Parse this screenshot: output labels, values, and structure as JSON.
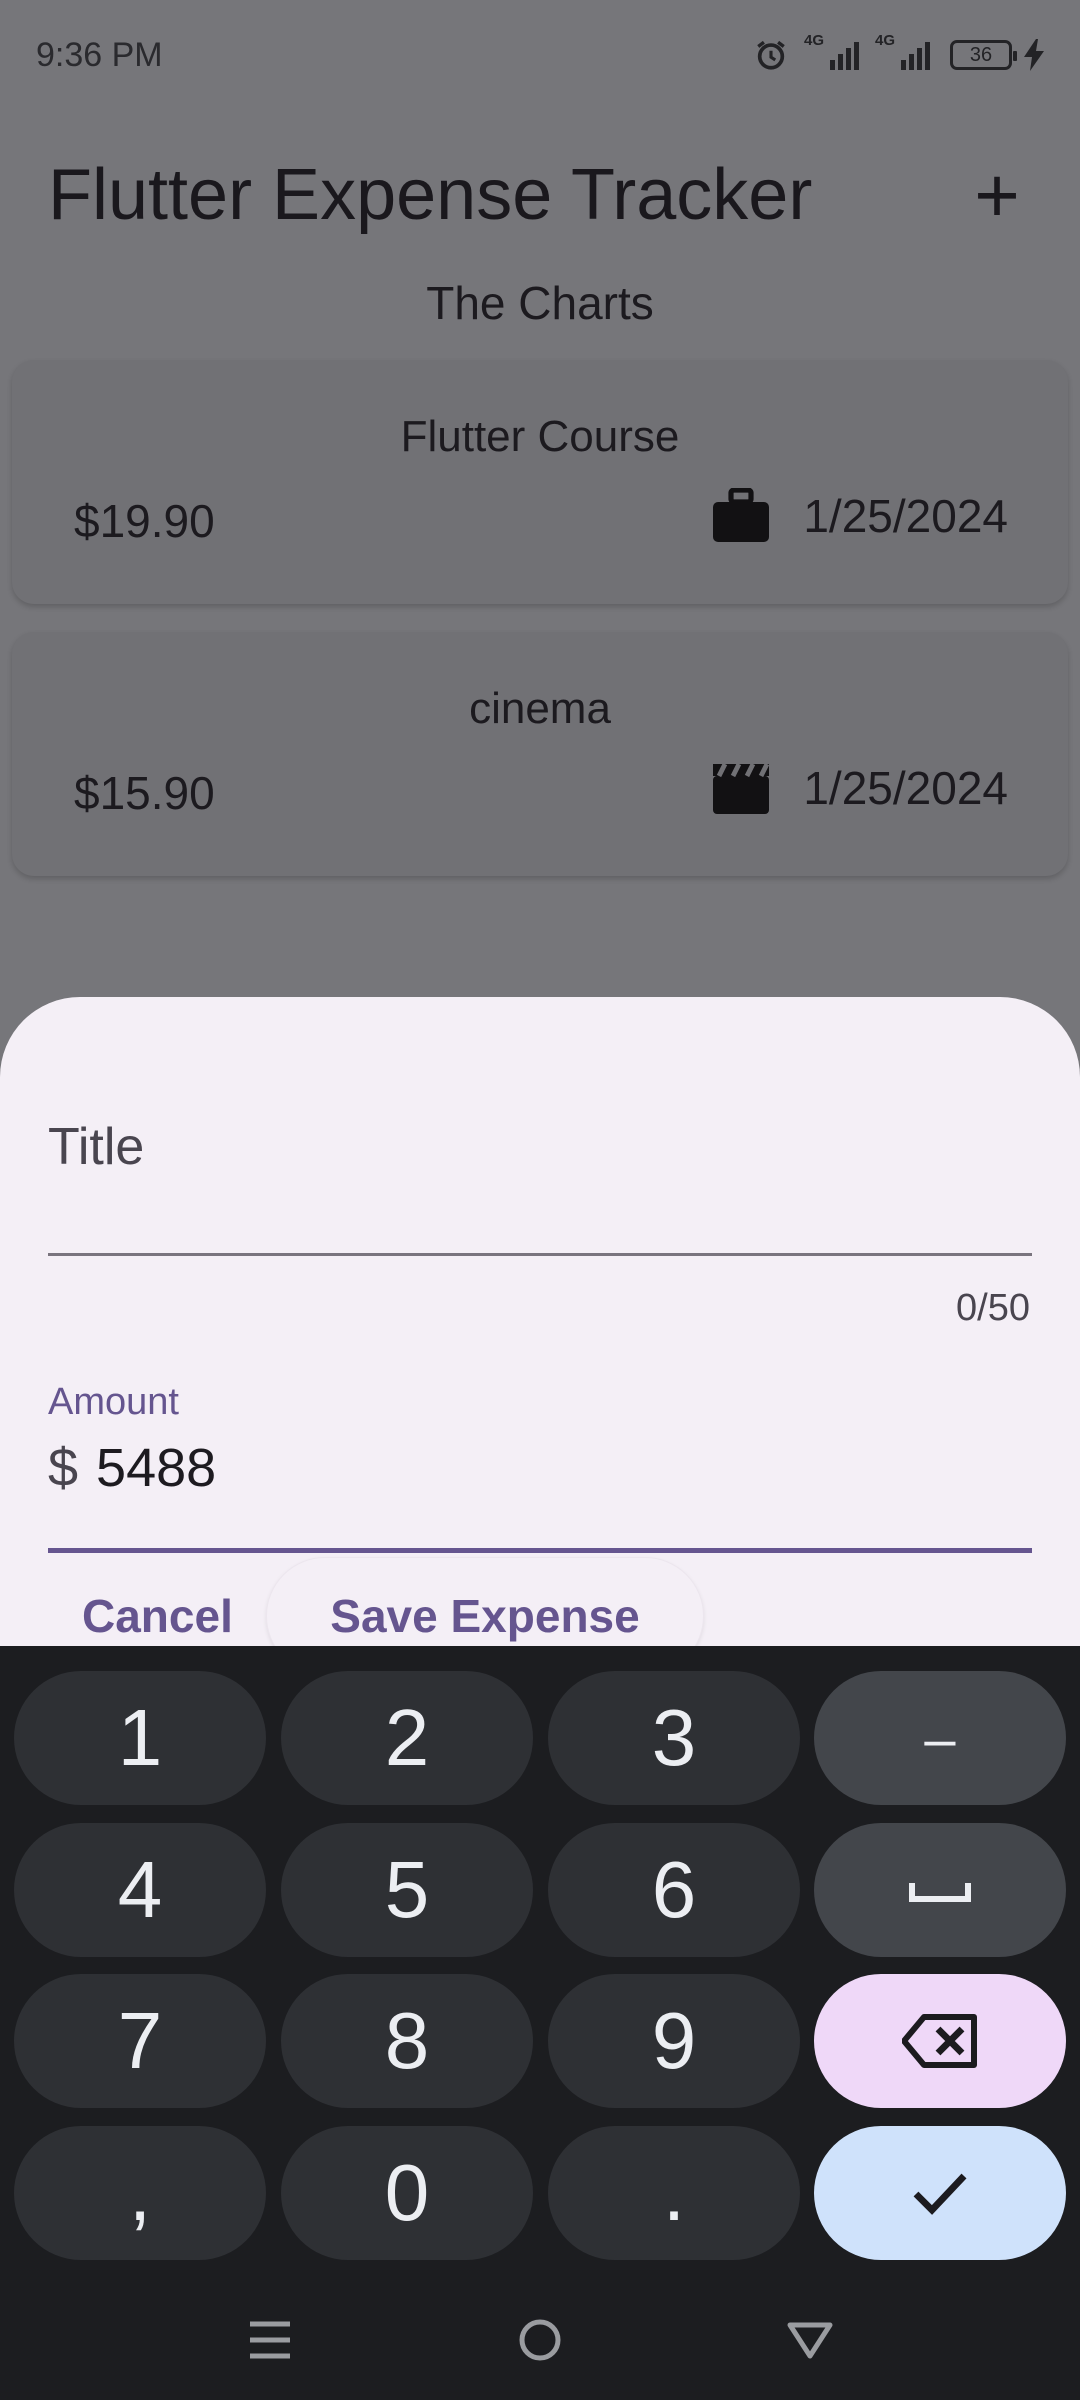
{
  "status_bar": {
    "time": "9:36 PM",
    "network_1": "4G",
    "network_2": "4G",
    "battery": "36",
    "icons": [
      "alarm-icon",
      "signal-icon",
      "signal-icon",
      "battery-icon",
      "charging-icon"
    ]
  },
  "app_bar": {
    "title": "Flutter Expense Tracker",
    "add_icon": "+"
  },
  "charts_label": "The Charts",
  "expenses": [
    {
      "title": "Flutter Course",
      "amount": "$19.90",
      "category_icon": "briefcase-icon",
      "date": "1/25/2024"
    },
    {
      "title": "cinema",
      "amount": "$15.90",
      "category_icon": "movie-clapper-icon",
      "date": "1/25/2024"
    }
  ],
  "form": {
    "title_label": "Title",
    "title_value": "",
    "title_counter": "0/50",
    "amount_label": "Amount",
    "amount_prefix": "$",
    "amount_value": "5488",
    "cancel_label": "Cancel",
    "save_label": "Save Expense",
    "accent_color": "#65558f"
  },
  "keyboard": {
    "rows": [
      [
        "1",
        "2",
        "3",
        "–"
      ],
      [
        "4",
        "5",
        "6",
        "space"
      ],
      [
        "7",
        "8",
        "9",
        "backspace"
      ],
      [
        ",",
        "0",
        ".",
        "done"
      ]
    ],
    "k1": "1",
    "k2": "2",
    "k3": "3",
    "k_minus": "–",
    "k4": "4",
    "k5": "5",
    "k6": "6",
    "k7": "7",
    "k8": "8",
    "k9": "9",
    "k_comma": ",",
    "k0": "0",
    "k_period": ".",
    "backspace_color": "#efd8f8",
    "done_color": "#cfe2fb"
  },
  "nav_bar": {
    "icons": [
      "menu-icon",
      "home-icon",
      "back-icon"
    ]
  }
}
